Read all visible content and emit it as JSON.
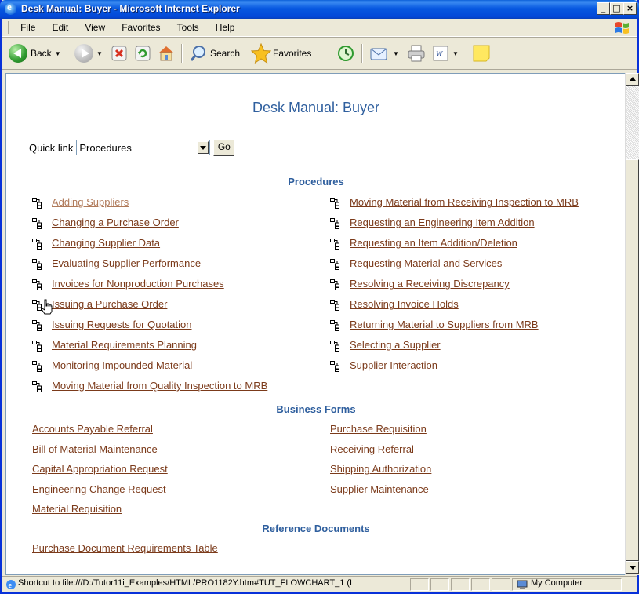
{
  "window": {
    "title": "Desk Manual: Buyer - Microsoft Internet Explorer",
    "controls": {
      "minimize": "_",
      "maximize": "□",
      "close": "×"
    }
  },
  "menubar": {
    "items": [
      "File",
      "Edit",
      "View",
      "Favorites",
      "Tools",
      "Help"
    ]
  },
  "toolbar": {
    "back_label": "Back",
    "search_label": "Search",
    "favorites_label": "Favorites"
  },
  "page": {
    "title": "Desk Manual: Buyer",
    "quicklink_label": "Quick link",
    "quicklink_value": "Procedures",
    "go_label": "Go"
  },
  "procedures": {
    "heading": "Procedures",
    "left": [
      "Adding Suppliers",
      "Changing a Purchase Order",
      "Changing Supplier Data",
      "Evaluating Supplier Performance",
      "Invoices for Nonproduction Purchases",
      "Issuing a Purchase Order",
      "Issuing Requests for Quotation",
      "Material Requirements Planning",
      "Monitoring Impounded Material",
      "Moving Material from Quality Inspection to MRB"
    ],
    "right": [
      "Moving Material from Receiving Inspection to MRB",
      "Requesting an Engineering Item Addition",
      "Requesting an Item Addition/Deletion",
      "Requesting Material and Services",
      "Resolving a Receiving Discrepancy",
      "Resolving Invoice Holds",
      "Returning Material to Suppliers from MRB",
      "Selecting a Supplier",
      "Supplier Interaction"
    ]
  },
  "business_forms": {
    "heading": "Business Forms",
    "left": [
      "Accounts Payable Referral",
      "Bill of Material Maintenance",
      "Capital Appropriation Request",
      "Engineering Change Request",
      "Material Requisition"
    ],
    "right": [
      "Purchase Requisition",
      "Receiving Referral",
      "Shipping Authorization",
      "Supplier Maintenance"
    ]
  },
  "reference_documents": {
    "heading": "Reference Documents",
    "items": [
      "Purchase Document Requirements Table"
    ]
  },
  "statusbar": {
    "text": "Shortcut to file:///D:/Tutor11i_Examples/HTML/PRO1182Y.htm#TUT_FLOWCHART_1 (I",
    "zone": "My Computer"
  }
}
